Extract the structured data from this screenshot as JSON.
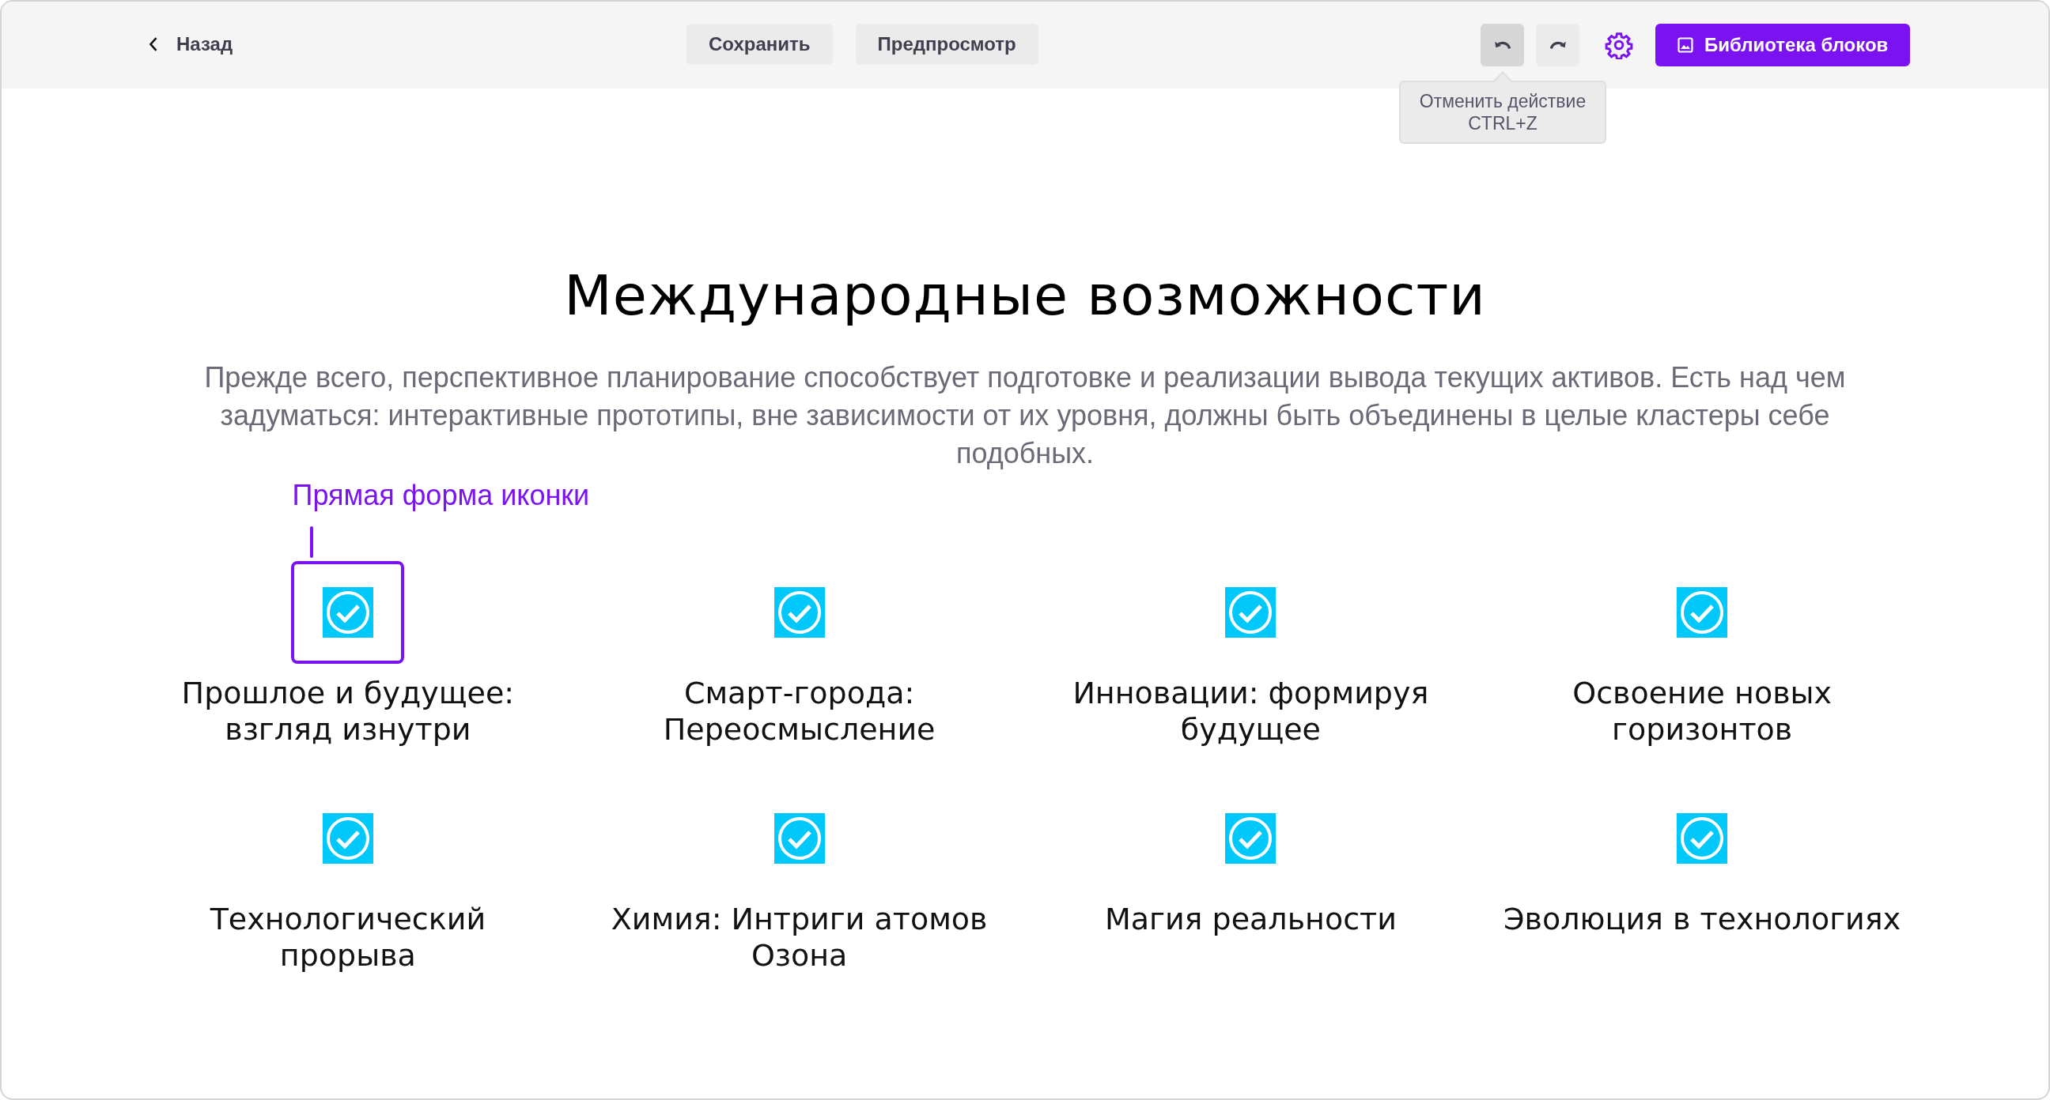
{
  "toolbar": {
    "back": {
      "label": "Назад"
    },
    "buttons": [
      {
        "label": "Сохранить"
      },
      {
        "label": "Предпросмотр"
      }
    ],
    "undo": {
      "hovered": true,
      "tooltip": [
        "Отменить действие",
        "CTRL+Z"
      ]
    },
    "library_button": {
      "label": "Библиотека блоков"
    }
  },
  "section": {
    "title": "Международные возможности",
    "description": "Прежде всего, перспективное планирование способствует подготовке и реализации вывода текущих активов. Есть над чем задуматься: интерактивные прототипы, вне зависимости от их уровня, должны быть объединены в целые кластеры себе подобных.",
    "annotation": "Прямая форма иконки",
    "items": [
      {
        "title": "Прошлое и будущее: взгляд изнутри",
        "selected": true
      },
      {
        "title": "Смарт-города: Переосмысление",
        "selected": false
      },
      {
        "title": "Инновации: формируя будущее",
        "selected": false
      },
      {
        "title": "Освоение новых горизонтов",
        "selected": false
      },
      {
        "title": "Технологический прорыва",
        "selected": false
      },
      {
        "title": "Химия: Интриги атомов Озона",
        "selected": false
      },
      {
        "title": "Магия реальности",
        "selected": false
      },
      {
        "title": "Эволюция в технологиях",
        "selected": false
      }
    ]
  }
}
